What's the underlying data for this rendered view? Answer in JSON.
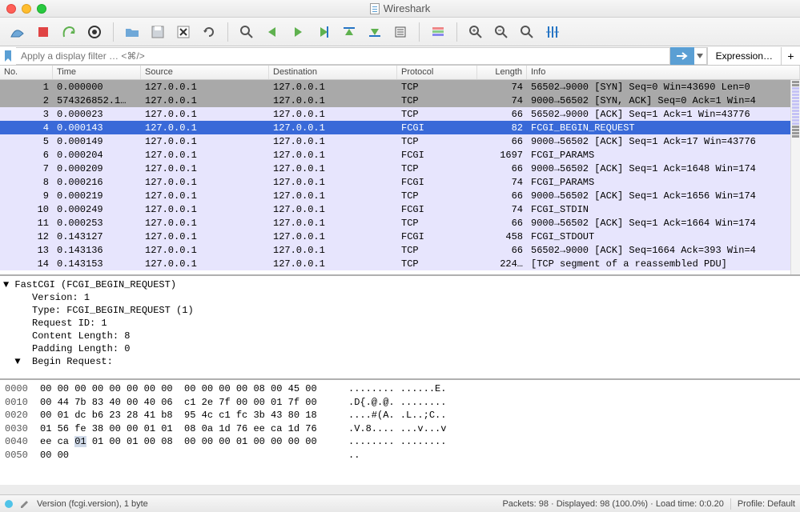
{
  "window": {
    "title": "Wireshark"
  },
  "filter": {
    "placeholder": "Apply a display filter … <⌘/>",
    "expression_label": "Expression…"
  },
  "columns": {
    "no": "No.",
    "time": "Time",
    "source": "Source",
    "destination": "Destination",
    "protocol": "Protocol",
    "length": "Length",
    "info": "Info"
  },
  "packets": [
    {
      "no": "1",
      "time": "0.000000",
      "src": "127.0.0.1",
      "dst": "127.0.0.1",
      "proto": "TCP",
      "len": "74",
      "info": "56502→9000 [SYN] Seq=0 Win=43690 Len=0",
      "bg": "gray"
    },
    {
      "no": "2",
      "time": "574326852.1…",
      "src": "127.0.0.1",
      "dst": "127.0.0.1",
      "proto": "TCP",
      "len": "74",
      "info": "9000→56502 [SYN, ACK] Seq=0 Ack=1 Win=4",
      "bg": "gray"
    },
    {
      "no": "3",
      "time": "0.000023",
      "src": "127.0.0.1",
      "dst": "127.0.0.1",
      "proto": "TCP",
      "len": "66",
      "info": "56502→9000 [ACK] Seq=1 Ack=1 Win=43776",
      "bg": "lav"
    },
    {
      "no": "4",
      "time": "0.000143",
      "src": "127.0.0.1",
      "dst": "127.0.0.1",
      "proto": "FCGI",
      "len": "82",
      "info": "FCGI_BEGIN_REQUEST",
      "bg": "sel"
    },
    {
      "no": "5",
      "time": "0.000149",
      "src": "127.0.0.1",
      "dst": "127.0.0.1",
      "proto": "TCP",
      "len": "66",
      "info": "9000→56502 [ACK] Seq=1 Ack=17 Win=43776",
      "bg": "lav"
    },
    {
      "no": "6",
      "time": "0.000204",
      "src": "127.0.0.1",
      "dst": "127.0.0.1",
      "proto": "FCGI",
      "len": "1697",
      "info": "FCGI_PARAMS",
      "bg": "lav"
    },
    {
      "no": "7",
      "time": "0.000209",
      "src": "127.0.0.1",
      "dst": "127.0.0.1",
      "proto": "TCP",
      "len": "66",
      "info": "9000→56502 [ACK] Seq=1 Ack=1648 Win=174",
      "bg": "lav"
    },
    {
      "no": "8",
      "time": "0.000216",
      "src": "127.0.0.1",
      "dst": "127.0.0.1",
      "proto": "FCGI",
      "len": "74",
      "info": "FCGI_PARAMS",
      "bg": "lav"
    },
    {
      "no": "9",
      "time": "0.000219",
      "src": "127.0.0.1",
      "dst": "127.0.0.1",
      "proto": "TCP",
      "len": "66",
      "info": "9000→56502 [ACK] Seq=1 Ack=1656 Win=174",
      "bg": "lav"
    },
    {
      "no": "10",
      "time": "0.000249",
      "src": "127.0.0.1",
      "dst": "127.0.0.1",
      "proto": "FCGI",
      "len": "74",
      "info": "FCGI_STDIN",
      "bg": "lav"
    },
    {
      "no": "11",
      "time": "0.000253",
      "src": "127.0.0.1",
      "dst": "127.0.0.1",
      "proto": "TCP",
      "len": "66",
      "info": "9000→56502 [ACK] Seq=1 Ack=1664 Win=174",
      "bg": "lav"
    },
    {
      "no": "12",
      "time": "0.143127",
      "src": "127.0.0.1",
      "dst": "127.0.0.1",
      "proto": "FCGI",
      "len": "458",
      "info": "FCGI_STDOUT",
      "bg": "lav"
    },
    {
      "no": "13",
      "time": "0.143136",
      "src": "127.0.0.1",
      "dst": "127.0.0.1",
      "proto": "TCP",
      "len": "66",
      "info": "56502→9000 [ACK] Seq=1664 Ack=393 Win=4",
      "bg": "lav"
    },
    {
      "no": "14",
      "time": "0.143153",
      "src": "127.0.0.1",
      "dst": "127.0.0.1",
      "proto": "TCP",
      "len": "224…",
      "info": "[TCP segment of a reassembled PDU]",
      "bg": "lav"
    }
  ],
  "detail": {
    "l0": "▼ FastCGI (FCGI_BEGIN_REQUEST)",
    "l1": "     Version: 1",
    "l2": "     Type: FCGI_BEGIN_REQUEST (1)",
    "l3": "     Request ID: 1",
    "l4": "     Content Length: 8",
    "l5": "     Padding Length: 0",
    "l6": "  ▼  Begin Request:"
  },
  "hex": [
    {
      "off": "0000",
      "b": "00 00 00 00 00 00 00 00  00 00 00 00 08 00 45 00",
      "a": "........ ......E."
    },
    {
      "off": "0010",
      "b": "00 44 7b 83 40 00 40 06  c1 2e 7f 00 00 01 7f 00",
      "a": ".D{.@.@. ........"
    },
    {
      "off": "0020",
      "b": "00 01 dc b6 23 28 41 b8  95 4c c1 fc 3b 43 80 18",
      "a": "....#(A. .L..;C.."
    },
    {
      "off": "0030",
      "b": "01 56 fe 38 00 00 01 01  08 0a 1d 76 ee ca 1d 76",
      "a": ".V.8.... ...v...v"
    },
    {
      "off": "0040",
      "b": "ee ca 01 01 00 01 00 08  00 00 00 01 00 00 00 00",
      "a": "........ ........",
      "hlStart": 6,
      "hlEnd": 8
    },
    {
      "off": "0050",
      "b": "00 00",
      "a": ".."
    }
  ],
  "status": {
    "field": "Version (fcgi.version), 1 byte",
    "packets": "Packets: 98 · Displayed: 98 (100.0%) · Load time: 0:0.20",
    "profile": "Profile: Default"
  }
}
